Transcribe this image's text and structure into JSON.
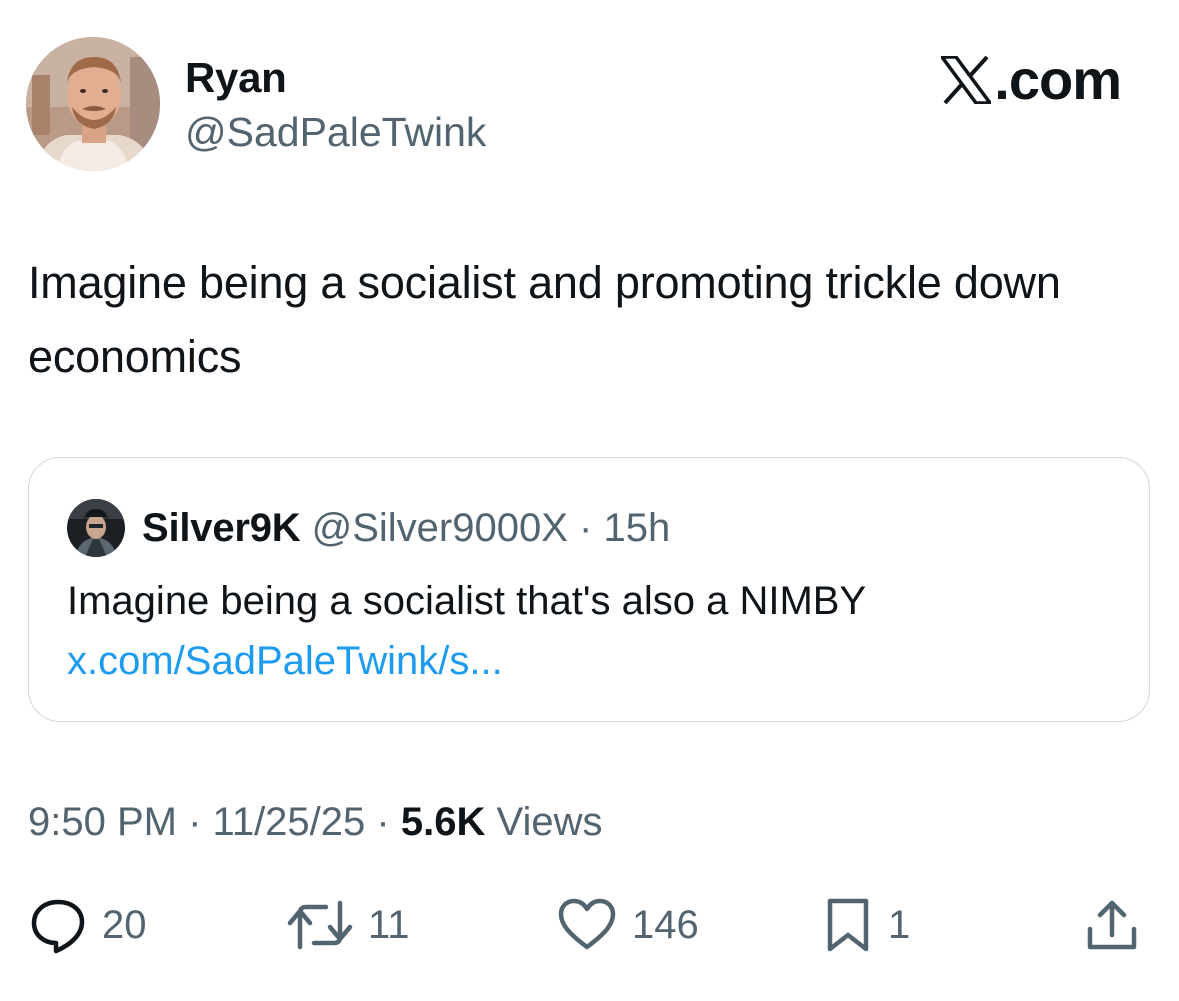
{
  "author": {
    "name": "Ryan",
    "handle": "@SadPaleTwink"
  },
  "brand": {
    "text": ".com"
  },
  "tweet": {
    "text": "Imagine being a socialist and promoting trickle down economics"
  },
  "quote": {
    "name": "Silver9K",
    "handle": "@Silver9000X",
    "separator": "·",
    "time": "15h",
    "text": "Imagine being a socialist that's also a NIMBY",
    "link": "x.com/SadPaleTwink/s..."
  },
  "meta": {
    "time": "9:50 PM",
    "separator": "·",
    "date": "11/25/25",
    "views_count": "5.6K",
    "views_label": "Views"
  },
  "actions": {
    "replies": "20",
    "reposts": "11",
    "likes": "146",
    "bookmarks": "1"
  },
  "icons": {
    "reply": "reply-icon",
    "repost": "repost-icon",
    "like": "heart-icon",
    "bookmark": "bookmark-icon",
    "share": "share-icon"
  },
  "colors": {
    "text": "#0f1419",
    "secondary": "#536471",
    "link": "#1d9bf0",
    "border": "#cfd9de"
  }
}
